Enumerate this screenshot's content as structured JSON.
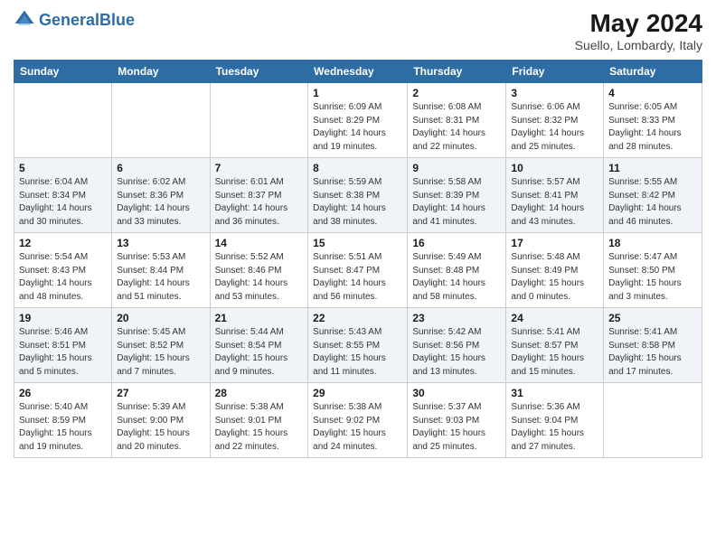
{
  "header": {
    "logo_general": "General",
    "logo_blue": "Blue",
    "month_title": "May 2024",
    "location": "Suello, Lombardy, Italy"
  },
  "days_of_week": [
    "Sunday",
    "Monday",
    "Tuesday",
    "Wednesday",
    "Thursday",
    "Friday",
    "Saturday"
  ],
  "weeks": [
    [
      {
        "num": "",
        "info": ""
      },
      {
        "num": "",
        "info": ""
      },
      {
        "num": "",
        "info": ""
      },
      {
        "num": "1",
        "info": "Sunrise: 6:09 AM\nSunset: 8:29 PM\nDaylight: 14 hours\nand 19 minutes."
      },
      {
        "num": "2",
        "info": "Sunrise: 6:08 AM\nSunset: 8:31 PM\nDaylight: 14 hours\nand 22 minutes."
      },
      {
        "num": "3",
        "info": "Sunrise: 6:06 AM\nSunset: 8:32 PM\nDaylight: 14 hours\nand 25 minutes."
      },
      {
        "num": "4",
        "info": "Sunrise: 6:05 AM\nSunset: 8:33 PM\nDaylight: 14 hours\nand 28 minutes."
      }
    ],
    [
      {
        "num": "5",
        "info": "Sunrise: 6:04 AM\nSunset: 8:34 PM\nDaylight: 14 hours\nand 30 minutes."
      },
      {
        "num": "6",
        "info": "Sunrise: 6:02 AM\nSunset: 8:36 PM\nDaylight: 14 hours\nand 33 minutes."
      },
      {
        "num": "7",
        "info": "Sunrise: 6:01 AM\nSunset: 8:37 PM\nDaylight: 14 hours\nand 36 minutes."
      },
      {
        "num": "8",
        "info": "Sunrise: 5:59 AM\nSunset: 8:38 PM\nDaylight: 14 hours\nand 38 minutes."
      },
      {
        "num": "9",
        "info": "Sunrise: 5:58 AM\nSunset: 8:39 PM\nDaylight: 14 hours\nand 41 minutes."
      },
      {
        "num": "10",
        "info": "Sunrise: 5:57 AM\nSunset: 8:41 PM\nDaylight: 14 hours\nand 43 minutes."
      },
      {
        "num": "11",
        "info": "Sunrise: 5:55 AM\nSunset: 8:42 PM\nDaylight: 14 hours\nand 46 minutes."
      }
    ],
    [
      {
        "num": "12",
        "info": "Sunrise: 5:54 AM\nSunset: 8:43 PM\nDaylight: 14 hours\nand 48 minutes."
      },
      {
        "num": "13",
        "info": "Sunrise: 5:53 AM\nSunset: 8:44 PM\nDaylight: 14 hours\nand 51 minutes."
      },
      {
        "num": "14",
        "info": "Sunrise: 5:52 AM\nSunset: 8:46 PM\nDaylight: 14 hours\nand 53 minutes."
      },
      {
        "num": "15",
        "info": "Sunrise: 5:51 AM\nSunset: 8:47 PM\nDaylight: 14 hours\nand 56 minutes."
      },
      {
        "num": "16",
        "info": "Sunrise: 5:49 AM\nSunset: 8:48 PM\nDaylight: 14 hours\nand 58 minutes."
      },
      {
        "num": "17",
        "info": "Sunrise: 5:48 AM\nSunset: 8:49 PM\nDaylight: 15 hours\nand 0 minutes."
      },
      {
        "num": "18",
        "info": "Sunrise: 5:47 AM\nSunset: 8:50 PM\nDaylight: 15 hours\nand 3 minutes."
      }
    ],
    [
      {
        "num": "19",
        "info": "Sunrise: 5:46 AM\nSunset: 8:51 PM\nDaylight: 15 hours\nand 5 minutes."
      },
      {
        "num": "20",
        "info": "Sunrise: 5:45 AM\nSunset: 8:52 PM\nDaylight: 15 hours\nand 7 minutes."
      },
      {
        "num": "21",
        "info": "Sunrise: 5:44 AM\nSunset: 8:54 PM\nDaylight: 15 hours\nand 9 minutes."
      },
      {
        "num": "22",
        "info": "Sunrise: 5:43 AM\nSunset: 8:55 PM\nDaylight: 15 hours\nand 11 minutes."
      },
      {
        "num": "23",
        "info": "Sunrise: 5:42 AM\nSunset: 8:56 PM\nDaylight: 15 hours\nand 13 minutes."
      },
      {
        "num": "24",
        "info": "Sunrise: 5:41 AM\nSunset: 8:57 PM\nDaylight: 15 hours\nand 15 minutes."
      },
      {
        "num": "25",
        "info": "Sunrise: 5:41 AM\nSunset: 8:58 PM\nDaylight: 15 hours\nand 17 minutes."
      }
    ],
    [
      {
        "num": "26",
        "info": "Sunrise: 5:40 AM\nSunset: 8:59 PM\nDaylight: 15 hours\nand 19 minutes."
      },
      {
        "num": "27",
        "info": "Sunrise: 5:39 AM\nSunset: 9:00 PM\nDaylight: 15 hours\nand 20 minutes."
      },
      {
        "num": "28",
        "info": "Sunrise: 5:38 AM\nSunset: 9:01 PM\nDaylight: 15 hours\nand 22 minutes."
      },
      {
        "num": "29",
        "info": "Sunrise: 5:38 AM\nSunset: 9:02 PM\nDaylight: 15 hours\nand 24 minutes."
      },
      {
        "num": "30",
        "info": "Sunrise: 5:37 AM\nSunset: 9:03 PM\nDaylight: 15 hours\nand 25 minutes."
      },
      {
        "num": "31",
        "info": "Sunrise: 5:36 AM\nSunset: 9:04 PM\nDaylight: 15 hours\nand 27 minutes."
      },
      {
        "num": "",
        "info": ""
      }
    ]
  ]
}
